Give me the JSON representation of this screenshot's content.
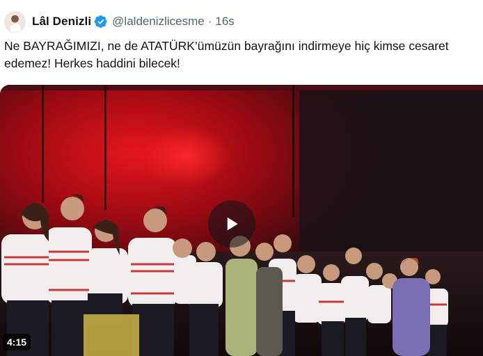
{
  "tweet": {
    "author": {
      "display_name": "Lâl Denizli",
      "handle": "@laldenizlicesme",
      "verified": true,
      "avatar_icon": "avatar-photo"
    },
    "separator": "·",
    "time": "16s",
    "text": "Ne BAYRAĞIMIZI, ne de ATATÜRK’ümüzün bayrağını indirmeye hiç kimse cesaret edemez! Herkes haddini bilecek!",
    "media": {
      "type": "video",
      "duration": "4:15",
      "play_icon": "play-icon"
    }
  },
  "colors": {
    "verified": "#1d9bf0",
    "muted_text": "#536471",
    "stage_red": "#c0121a"
  }
}
